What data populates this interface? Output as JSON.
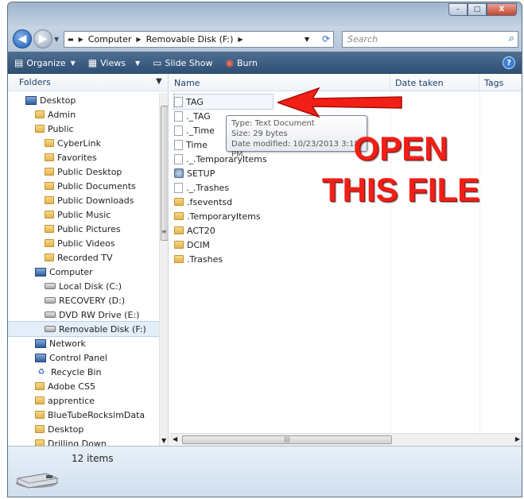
{
  "window": {
    "minimize": "–",
    "maximize": "□",
    "close": "X"
  },
  "address": {
    "segments": [
      "Computer",
      "Removable Disk (F:)"
    ],
    "search_placeholder": "Search"
  },
  "toolbar": {
    "organize": "Organize",
    "views": "Views",
    "slideshow": "Slide Show",
    "burn": "Burn",
    "help": "?"
  },
  "navpane": {
    "header": "Folders",
    "items": [
      {
        "label": "Desktop",
        "indent": 0,
        "icon": "desktop-icon"
      },
      {
        "label": "Admin",
        "indent": 1,
        "icon": "user-folder-icon"
      },
      {
        "label": "Public",
        "indent": 1,
        "icon": "folder-icon"
      },
      {
        "label": "CyberLink",
        "indent": 2,
        "icon": "folder-icon"
      },
      {
        "label": "Favorites",
        "indent": 2,
        "icon": "folder-icon"
      },
      {
        "label": "Public Desktop",
        "indent": 2,
        "icon": "folder-icon"
      },
      {
        "label": "Public Documents",
        "indent": 2,
        "icon": "folder-icon"
      },
      {
        "label": "Public Downloads",
        "indent": 2,
        "icon": "folder-icon"
      },
      {
        "label": "Public Music",
        "indent": 2,
        "icon": "folder-icon"
      },
      {
        "label": "Public Pictures",
        "indent": 2,
        "icon": "folder-icon"
      },
      {
        "label": "Public Videos",
        "indent": 2,
        "icon": "folder-icon"
      },
      {
        "label": "Recorded TV",
        "indent": 2,
        "icon": "folder-icon"
      },
      {
        "label": "Computer",
        "indent": 1,
        "icon": "computer-icon"
      },
      {
        "label": "Local Disk (C:)",
        "indent": 2,
        "icon": "drive-icon"
      },
      {
        "label": "RECOVERY (D:)",
        "indent": 2,
        "icon": "drive-icon"
      },
      {
        "label": "DVD RW Drive (E:)",
        "indent": 2,
        "icon": "dvd-drive-icon"
      },
      {
        "label": "Removable Disk (F:)",
        "indent": 2,
        "icon": "drive-icon",
        "selected": true
      },
      {
        "label": "Network",
        "indent": 1,
        "icon": "network-icon"
      },
      {
        "label": "Control Panel",
        "indent": 1,
        "icon": "control-panel-icon"
      },
      {
        "label": "Recycle Bin",
        "indent": 1,
        "icon": "recycle-bin-icon"
      },
      {
        "label": "Adobe CS5",
        "indent": 1,
        "icon": "folder-icon"
      },
      {
        "label": "apprentice",
        "indent": 1,
        "icon": "folder-icon"
      },
      {
        "label": "BlueTubeRocksimData",
        "indent": 1,
        "icon": "folder-icon"
      },
      {
        "label": "Desktop",
        "indent": 1,
        "icon": "folder-icon"
      },
      {
        "label": "Drilling Down",
        "indent": 1,
        "icon": "folder-icon"
      }
    ]
  },
  "columns": {
    "name": "Name",
    "date": "Date taken",
    "tags": "Tags"
  },
  "files": [
    {
      "name": "TAG",
      "icon": "document-icon",
      "selected": true
    },
    {
      "name": "._TAG",
      "icon": "document-icon"
    },
    {
      "name": "._Time",
      "icon": "document-icon"
    },
    {
      "name": "Time",
      "icon": "document-icon"
    },
    {
      "name": "._.TemporaryItems",
      "icon": "document-icon"
    },
    {
      "name": "SETUP",
      "icon": "setup-icon"
    },
    {
      "name": "._.Trashes",
      "icon": "document-icon"
    },
    {
      "name": ".fseventsd",
      "icon": "folder-icon"
    },
    {
      "name": ".TemporaryItems",
      "icon": "folder-icon"
    },
    {
      "name": "ACT20",
      "icon": "folder-icon"
    },
    {
      "name": "DCIM",
      "icon": "folder-icon"
    },
    {
      "name": ".Trashes",
      "icon": "folder-icon"
    }
  ],
  "tooltip": {
    "type": "Type: Text Document",
    "size": "Size: 29 bytes",
    "modified": "Date modified: 10/23/2013 3:18 PM"
  },
  "annotation": {
    "line1": "OPEN",
    "line2": "THIS FILE",
    "color": "#f21f17"
  },
  "details": {
    "count": "12 items"
  }
}
